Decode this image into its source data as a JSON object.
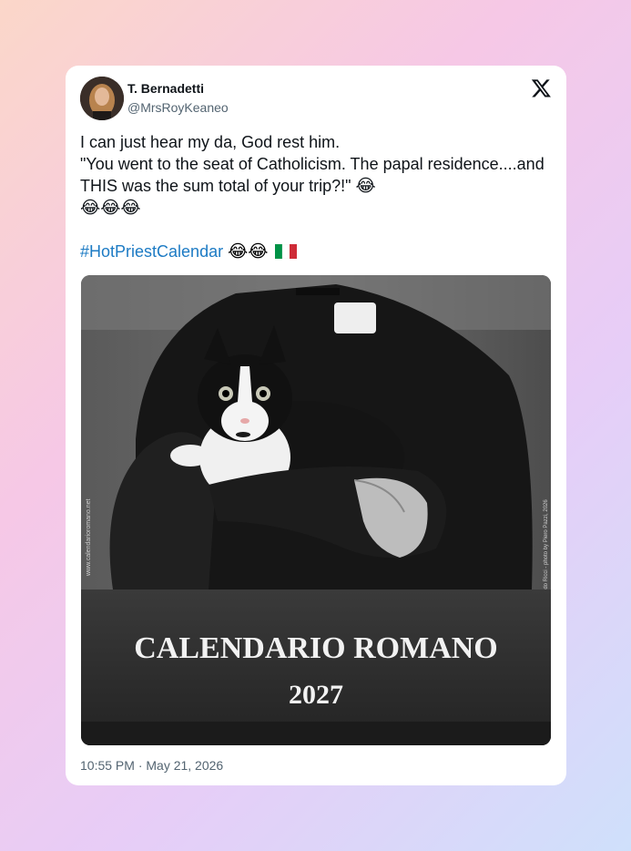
{
  "author": {
    "name": "T. Bernadetti",
    "handle": "@MrsRoyKeaneo"
  },
  "icons": {
    "platform": "x-logo-icon",
    "flag": "italy-flag-icon"
  },
  "tweet": {
    "line1": "I can just hear my da, God rest him.",
    "line2": "\"You went to the seat of Catholicism. The papal residence....and THIS was the sum total of your trip?!\"",
    "line2_emoji": "😂",
    "line3_emojis": "😂😂😂",
    "hashtag": "#HotPriestCalendar",
    "hashtag_emojis": "😂😂"
  },
  "image": {
    "calendar_title": "CALENDARIO ROMANO",
    "calendar_year": "2027",
    "side_text_left": "www.calendarioromano.net",
    "side_text_right": "Aldo Ricci - photo by Piero Pazzi, 2026"
  },
  "timestamp": "10:55 PM · May 21, 2026",
  "colors": {
    "hashtag": "#1d7bc4",
    "text": "#0f1419",
    "muted": "#536471"
  }
}
